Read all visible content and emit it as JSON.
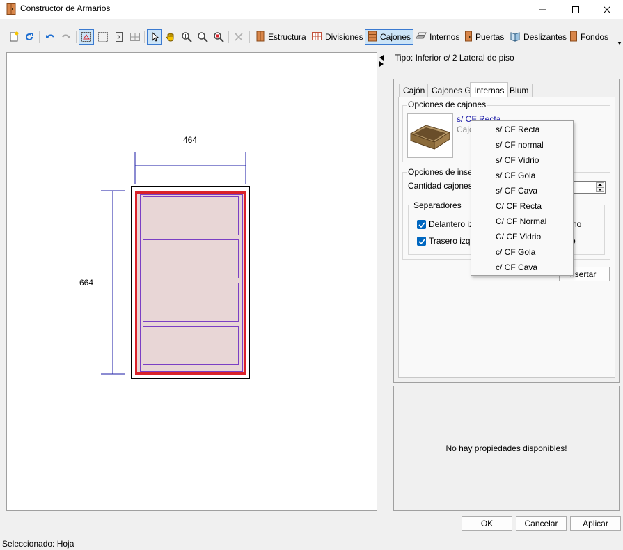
{
  "window": {
    "title": "Constructor de Armarios",
    "controls": [
      "minimize-icon",
      "maximize-icon",
      "close-icon"
    ]
  },
  "toolbar": {
    "icon_buttons": [
      "new-icon",
      "refresh-icon",
      "undo-icon",
      "redo-icon",
      "select-region-icon",
      "select-rect-icon",
      "door-frame-icon",
      "grid-icon",
      "pointer-icon",
      "pan-hand-icon",
      "zoom-in-icon",
      "zoom-out-icon",
      "zoom-fit-icon",
      "delete-icon"
    ],
    "tabs": [
      {
        "label": "Estructura",
        "icon": "structure-icon"
      },
      {
        "label": "Divisiones",
        "icon": "grid-icon"
      },
      {
        "label": "Cajones",
        "icon": "drawer-icon",
        "active": true
      },
      {
        "label": "Internos",
        "icon": "internal-icon"
      },
      {
        "label": "Puertas",
        "icon": "door-icon"
      },
      {
        "label": "Deslizantes",
        "icon": "sliding-icon"
      },
      {
        "label": "Fondos",
        "icon": "back-panel-icon"
      }
    ]
  },
  "canvas": {
    "width_dim": "464",
    "height_dim": "664",
    "drawers": 4
  },
  "right": {
    "tipo_label": "Tipo: Inferior c/ 2 Lateral de piso",
    "tabs": [
      {
        "label": "Cajón"
      },
      {
        "label": "Cajones G"
      },
      {
        "label": "Internas",
        "active": true
      },
      {
        "label": "Blum"
      }
    ],
    "options_group": "Opciones de cajones",
    "selected_option": "s/ CF Recta",
    "selected_subtext": "Cajo",
    "insert_group": "Opciones de inserci",
    "cantidad_label": "Cantidad cajones:",
    "separadores_group": "Separadores",
    "delantero_label": "Delantero iz",
    "delantero_suffix": "ho",
    "trasero_label": "Trasero izqu",
    "trasero_suffix": "o",
    "insertar_button": "nsertar"
  },
  "dropdown": {
    "items": [
      "s/ CF Recta",
      "s/ CF normal",
      "s/ CF Vidrio",
      "s/ CF Gola",
      "s/ CF Cava",
      "C/ CF Recta",
      "C/ CF Normal",
      "C/ CF Vidrio",
      "c/ CF Gola",
      "c/ CF Cava"
    ]
  },
  "properties": {
    "empty_text": "No hay propiedades disponibles!"
  },
  "buttons": {
    "ok": "OK",
    "cancel": "Cancelar",
    "apply": "Aplicar"
  },
  "status": {
    "text": "Seleccionado: Hoja"
  },
  "colors": {
    "accent": "#0067c0",
    "selection_red": "#d9222a",
    "drawer_fill": "#e8d6d6",
    "drawer_stroke": "#7b3fc4",
    "dimension_blue": "#1a1aa6"
  }
}
